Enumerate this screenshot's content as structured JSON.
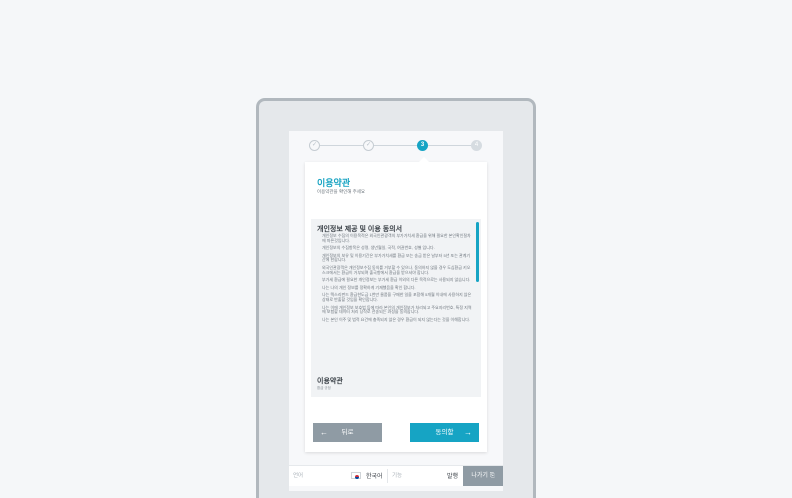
{
  "stepper": {
    "steps": [
      {
        "label": "✓",
        "state": "done"
      },
      {
        "label": "✓",
        "state": "done"
      },
      {
        "label": "3",
        "state": "active"
      },
      {
        "label": "4",
        "state": "future"
      }
    ]
  },
  "card": {
    "title": "이용약관",
    "subtitle": "이용약관을 확인해 주세요",
    "terms": {
      "section_title": "개인정보 제공 및 이용 동의서",
      "paragraphs": [
        "개인정보 수집의 이용목적은 외국인관광객의 부가가치세 환급을 위해 필요한 본인확인절차에 따른것입니다.",
        "개인정보의 수집항목은 성명, 생년월일, 국적, 여권번호, 성별 입니다.",
        "개인정보의 보유 및 이용기간은 부가가치세를 환급 또는 송금 받은 날부터 5년 또는 관계기간에 한합니다.",
        "외국인관광객은 개인정보수집 동의를 거부할 수 있으나, 동의하지 않을 경우 도심환급 키오스크에서는 환급이 거부되며 출국항에서 환급을 받으셔야 합니다.",
        "부가세 환급에 필요한 개인정보는 부가세 환급 이외의 다른 목적으로는 사용되지 않습니다.",
        "나는 나의 개인 정보를 정확하게 기재했음을 확인 합니다.",
        "나는 텍스리펀드 환급한도금 1천만 물품을 구매한 일을 포함해 5개월 이내에 사용하지 않은 상태로 반출할 것임을 확인합니다.",
        "나는 이에 개인정보 보호법 등에 따라 본인의 개인정보가 처리되고 주요지리번호, 특정 지역에 보험할 데이터 처리 당작로 전송되는 과정을 동의합니다.",
        "나는 본인 이주 및 법적 요건에 충족되지 않은 경우 환급이 되지 않는다는 것을 이해합니다."
      ],
      "section2_title": "이용약관",
      "section2_sub": "환급 규정"
    },
    "back_label": "뒤로",
    "agree_label": "동의함"
  },
  "bottom_bar": {
    "language_label": "언어",
    "language_value": "한국어",
    "function_label": "기능",
    "function_value": "발행",
    "exit_label": "나가기"
  },
  "colors": {
    "accent": "#16a4c4",
    "button_gray": "#8f9ba4",
    "frame": "#b1b8be"
  }
}
